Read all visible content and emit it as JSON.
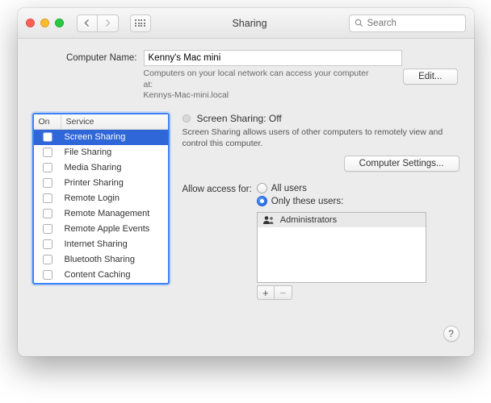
{
  "titlebar": {
    "title": "Sharing",
    "search_placeholder": "Search"
  },
  "top": {
    "computer_name_label": "Computer Name:",
    "computer_name_value": "Kenny's Mac mini",
    "network_text_1": "Computers on your local network can access your computer at:",
    "network_text_2": "Kennys-Mac-mini.local",
    "edit_label": "Edit..."
  },
  "services": {
    "col_on": "On",
    "col_service": "Service",
    "items": [
      {
        "label": "Screen Sharing"
      },
      {
        "label": "File Sharing"
      },
      {
        "label": "Media Sharing"
      },
      {
        "label": "Printer Sharing"
      },
      {
        "label": "Remote Login"
      },
      {
        "label": "Remote Management"
      },
      {
        "label": "Remote Apple Events"
      },
      {
        "label": "Internet Sharing"
      },
      {
        "label": "Bluetooth Sharing"
      },
      {
        "label": "Content Caching"
      }
    ]
  },
  "detail": {
    "status": "Screen Sharing: Off",
    "description": "Screen Sharing allows users of other computers to remotely view and control this computer.",
    "computer_settings_label": "Computer Settings...",
    "allow_label": "Allow access for:",
    "radio_all": "All users",
    "radio_only": "Only these users:",
    "user_admin": "Administrators",
    "plus": "+",
    "minus": "−"
  },
  "footer": {
    "help": "?"
  }
}
